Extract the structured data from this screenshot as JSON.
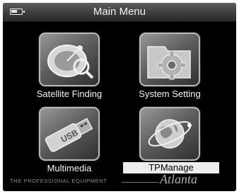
{
  "header": {
    "title": "Main Menu",
    "battery_icon": "battery-icon"
  },
  "menu": {
    "items": [
      {
        "label": "Satellite Finding",
        "icon": "satellite-dish-icon"
      },
      {
        "label": "System Setting",
        "icon": "gear-folder-icon"
      },
      {
        "label": "Multimedia",
        "icon": "usb-drive-icon"
      },
      {
        "label": "TPManage",
        "icon": "globe-orbit-icon",
        "selected": true
      }
    ]
  },
  "footer": {
    "tagline": "THE PROFESSIONAL EQUIPMENT",
    "brand": "Atlanta"
  }
}
